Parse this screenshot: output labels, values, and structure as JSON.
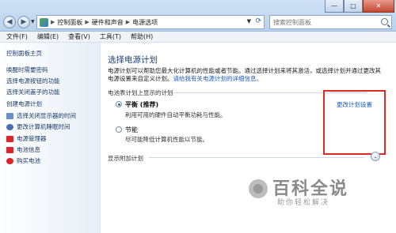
{
  "window": {
    "minimize": "—",
    "maximize": "□",
    "close": "✕"
  },
  "nav": {
    "back": "◀",
    "forward": "▶",
    "dropdown": "▼"
  },
  "breadcrumbs": [
    "控制面板",
    "硬件和声音",
    "电源选项"
  ],
  "breadcrumb_separator": "▶",
  "search": {
    "placeholder": "搜索控制面板"
  },
  "menubar": [
    "文件(F)",
    "编辑(E)",
    "查看(V)",
    "工具(T)",
    "帮助(H)"
  ],
  "sidebar": {
    "items": [
      {
        "label": "控制面板主页",
        "icon": ""
      },
      {
        "label": "唤醒时需要密码",
        "icon": ""
      },
      {
        "label": "选择电源按钮的功能",
        "icon": ""
      },
      {
        "label": "选择关闭盖子的功能",
        "icon": ""
      },
      {
        "label": "创建电源计划",
        "icon": ""
      },
      {
        "label": "选择关闭显示器的时间",
        "icon": "monitor-icon"
      },
      {
        "label": "更改计算机睡眠时间",
        "icon": "moon-icon"
      },
      {
        "label": "电源管理器",
        "icon": "battery-icon"
      },
      {
        "label": "电池信息",
        "icon": "battery-icon"
      },
      {
        "label": "购买电池",
        "icon": "globe-icon"
      }
    ]
  },
  "main": {
    "heading": "选择电源计划",
    "description": "电源计划可以帮助您最大化计算机的性能或者节能。通过选择计划来将其激活，或选择计划并通过更改其电源设置来自定义计划。",
    "description_link": "请给我有关电源计划的详细信息。",
    "section_label": "电池表计划上显示的计划",
    "plans": [
      {
        "name": "平衡 (推荐)",
        "desc": "利用可用的硬件自动平衡功耗与性能。",
        "link": "更改计划设置",
        "selected": true
      },
      {
        "name": "节能",
        "desc": "尽可能降低计算机性能以节能。",
        "link": "",
        "selected": false
      }
    ],
    "extra_label": "显示附加计划",
    "expand": "⌄"
  },
  "watermark": {
    "title": "百科全说",
    "subtitle": "助你轻松解决"
  },
  "colors": {
    "highlight_box": "#e02a21",
    "link": "#1e5bb8",
    "heading": "#1f3e78"
  }
}
